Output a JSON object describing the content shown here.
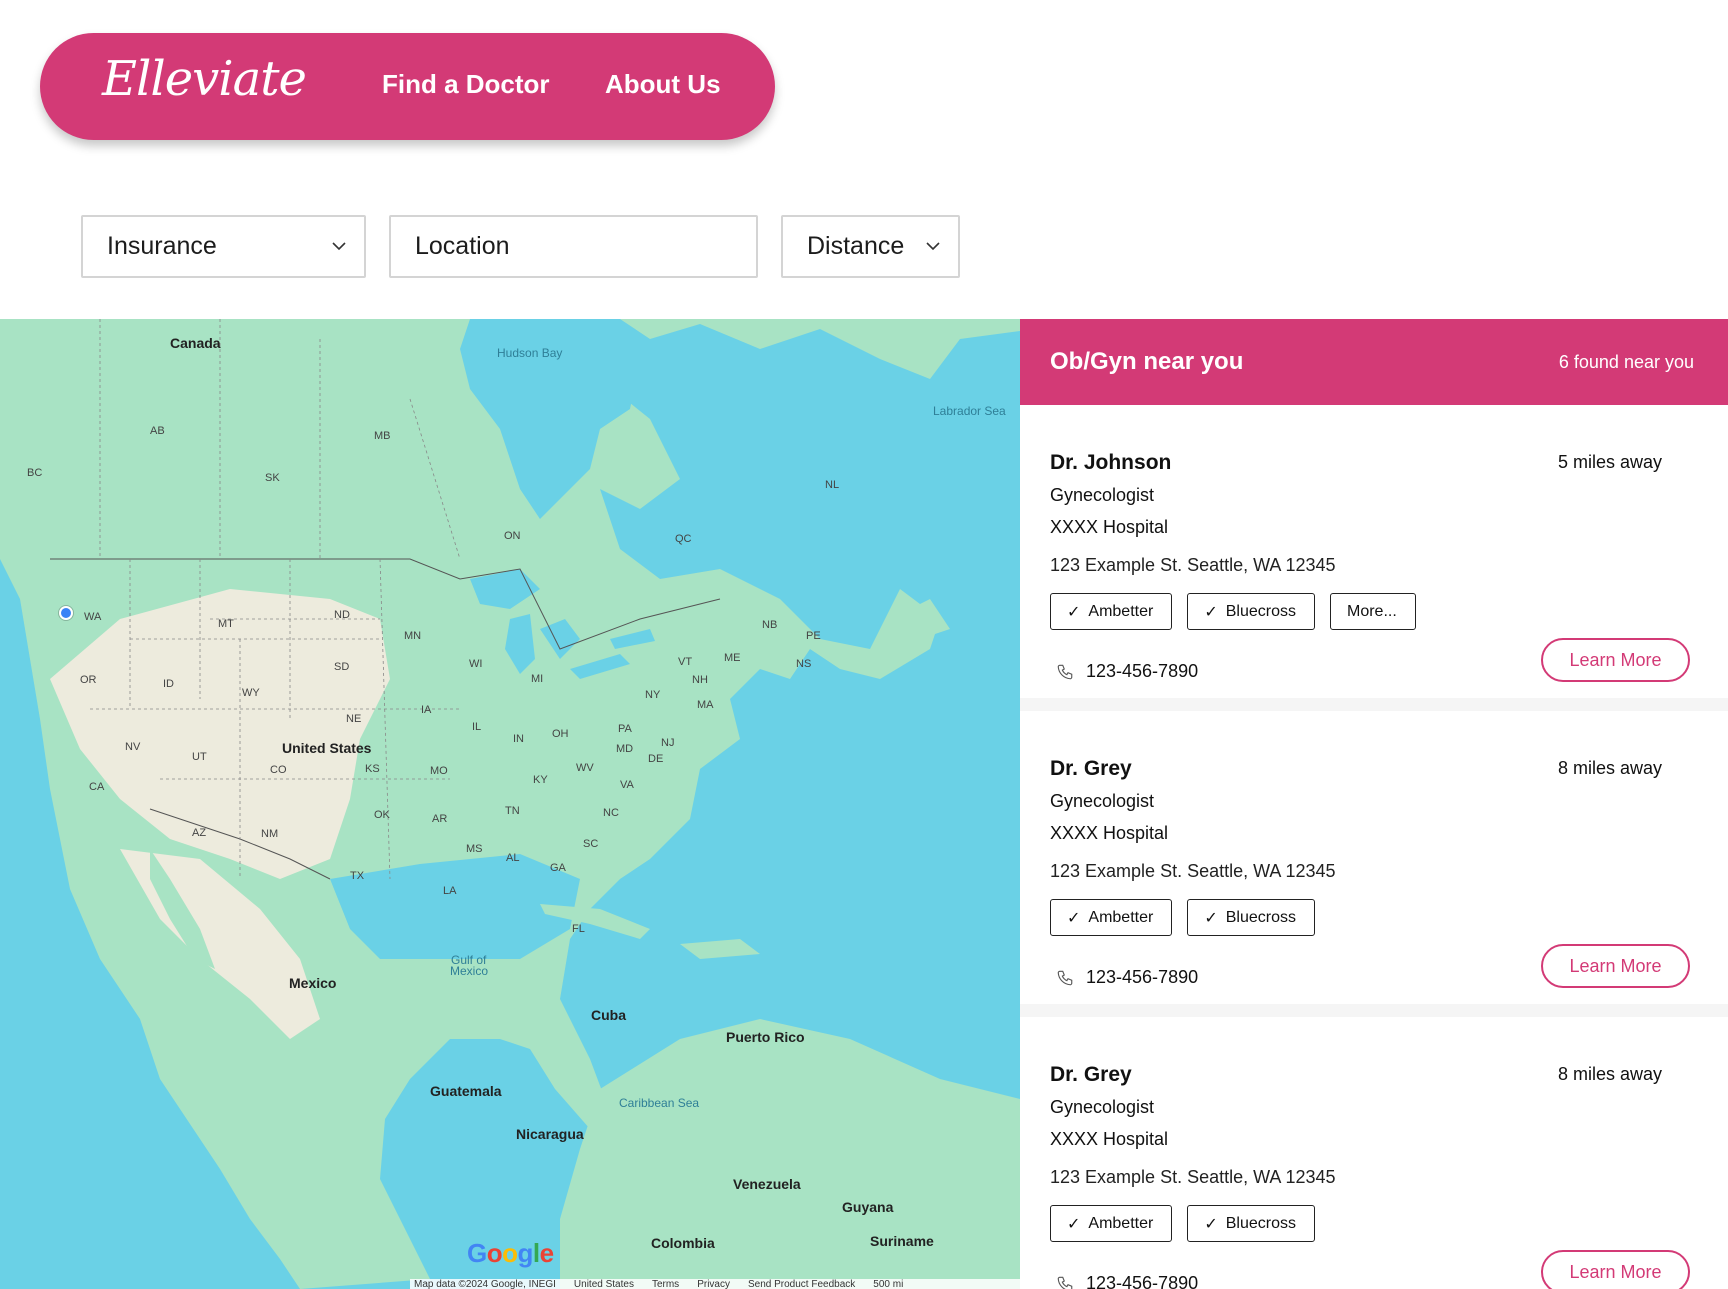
{
  "nav": {
    "logo": "Elleviate",
    "links": [
      "Find a Doctor",
      "About Us"
    ]
  },
  "filters": {
    "insurance": "Insurance",
    "location_placeholder": "Location",
    "distance": "Distance"
  },
  "map": {
    "labels": {
      "canada": "Canada",
      "hudson_bay": "Hudson Bay",
      "labrador_sea": "Labrador Sea",
      "ab": "AB",
      "bc": "BC",
      "mb": "MB",
      "sk": "SK",
      "on": "ON",
      "qc": "QC",
      "nl": "NL",
      "nb": "NB",
      "pe": "PE",
      "ns": "NS",
      "wa": "WA",
      "mt": "MT",
      "nd": "ND",
      "mn": "MN",
      "wi": "WI",
      "mi": "MI",
      "me": "ME",
      "vt": "VT",
      "nh": "NH",
      "ma": "MA",
      "ny": "NY",
      "nj": "NJ",
      "or": "OR",
      "id": "ID",
      "wy": "WY",
      "sd": "SD",
      "ne": "NE",
      "ia": "IA",
      "il": "IL",
      "in": "IN",
      "oh": "OH",
      "pa": "PA",
      "md": "MD",
      "de": "DE",
      "wv": "WV",
      "va": "VA",
      "nv": "NV",
      "ut": "UT",
      "co": "CO",
      "ks": "KS",
      "mo": "MO",
      "ky": "KY",
      "ca": "CA",
      "az": "AZ",
      "nm": "NM",
      "ok": "OK",
      "ar": "AR",
      "tn": "TN",
      "nc": "NC",
      "sc": "SC",
      "ms": "MS",
      "al": "AL",
      "ga": "GA",
      "tx": "TX",
      "la": "LA",
      "fl": "FL",
      "united_states": "United States",
      "mexico": "Mexico",
      "gulf": "Gulf of",
      "gulf2": "Mexico",
      "cuba": "Cuba",
      "puerto_rico": "Puerto Rico",
      "caribbean": "Caribbean Sea",
      "guatemala": "Guatemala",
      "nicaragua": "Nicaragua",
      "venezuela": "Venezuela",
      "guyana": "Guyana",
      "suriname": "Suriname",
      "colombia": "Colombia"
    },
    "google_logo": [
      "G",
      "o",
      "o",
      "g",
      "l",
      "e"
    ],
    "attribution": [
      "Map data ©2024 Google, INEGI",
      "United States",
      "Terms",
      "Privacy",
      "Send Product Feedback",
      "500 mi"
    ]
  },
  "results": {
    "title": "Ob/Gyn near you",
    "count": "6 found near you",
    "learn_more": "Learn More",
    "doctors": [
      {
        "name": "Dr. Johnson",
        "distance": "5 miles away",
        "specialty": "Gynecologist",
        "hospital": "XXXX Hospital",
        "address": "123 Example St. Seattle, WA 12345",
        "tags": [
          "Ambetter",
          "Bluecross"
        ],
        "more": "More...",
        "phone": "123-456-7890"
      },
      {
        "name": "Dr. Grey",
        "distance": "8 miles away",
        "specialty": "Gynecologist",
        "hospital": "XXXX Hospital",
        "address": "123 Example St. Seattle, WA 12345",
        "tags": [
          "Ambetter",
          "Bluecross"
        ],
        "phone": "123-456-7890"
      },
      {
        "name": "Dr. Grey",
        "distance": "8 miles away",
        "specialty": "Gynecologist",
        "hospital": "XXXX Hospital",
        "address": "123 Example St. Seattle, WA 12345",
        "tags": [
          "Ambetter",
          "Bluecross"
        ],
        "phone": "123-456-7890"
      }
    ]
  },
  "colors": {
    "brand": "#D33A76",
    "water": "#6AD1E6",
    "land": "#A8E3C4",
    "land_dry": "#EDEBDD"
  }
}
